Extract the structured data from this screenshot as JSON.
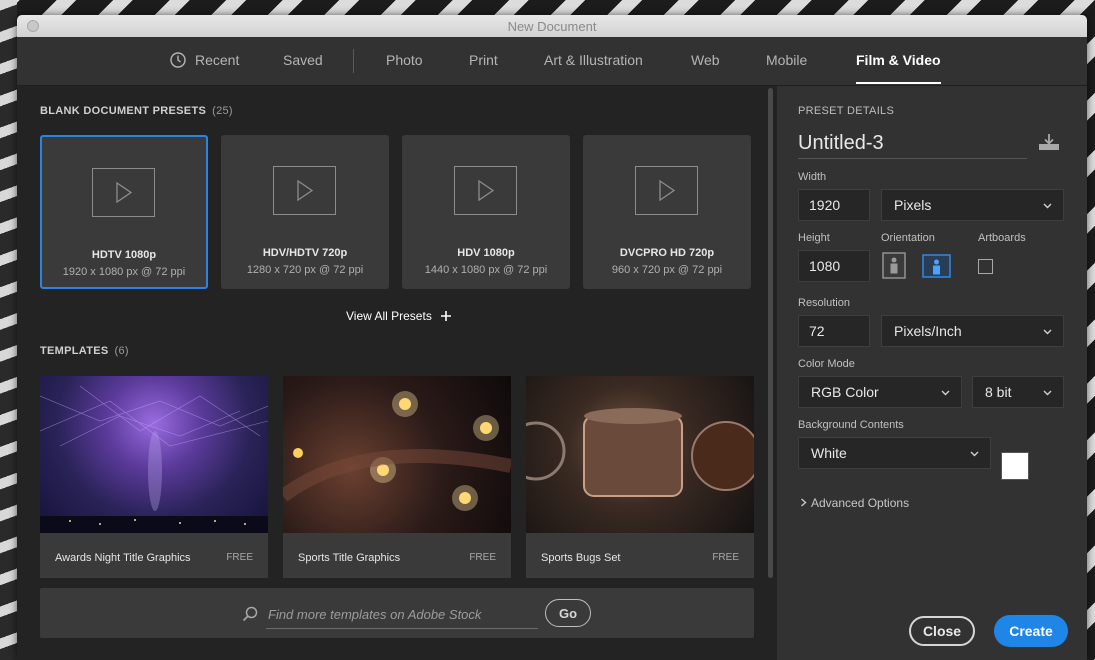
{
  "window": {
    "title": "New Document"
  },
  "tabs": [
    {
      "label": "Recent",
      "icon": "clock-icon"
    },
    {
      "label": "Saved"
    },
    {
      "label": "Photo"
    },
    {
      "label": "Print"
    },
    {
      "label": "Art & Illustration"
    },
    {
      "label": "Web"
    },
    {
      "label": "Mobile"
    },
    {
      "label": "Film & Video",
      "active": true
    }
  ],
  "presets_section": {
    "label": "BLANK DOCUMENT PRESETS",
    "count": "(25)"
  },
  "presets": [
    {
      "name": "HDTV 1080p",
      "dims": "1920 x 1080 px @ 72 ppi",
      "selected": true,
      "icon": "video-play-icon"
    },
    {
      "name": "HDV/HDTV 720p",
      "dims": "1280 x 720 px @ 72 ppi",
      "icon": "video-play-icon"
    },
    {
      "name": "HDV 1080p",
      "dims": "1440 x 1080 px @ 72 ppi",
      "icon": "video-play-icon"
    },
    {
      "name": "DVCPRO HD 720p",
      "dims": "960 x 720 px @ 72 ppi",
      "icon": "video-play-icon"
    }
  ],
  "view_all": {
    "label": "View All Presets",
    "icon": "plus-icon"
  },
  "templates_section": {
    "label": "TEMPLATES",
    "count": "(6)"
  },
  "templates": [
    {
      "name": "Awards Night Title Graphics",
      "price": "FREE"
    },
    {
      "name": "Sports Title Graphics",
      "price": "FREE"
    },
    {
      "name": "Sports Bugs Set",
      "price": "FREE"
    }
  ],
  "search": {
    "placeholder": "Find more templates on Adobe Stock",
    "value": "",
    "go_label": "Go",
    "icon": "search-icon"
  },
  "details": {
    "header": "PRESET DETAILS",
    "doc_name": "Untitled-3",
    "save_icon": "save-preset-icon",
    "width_label": "Width",
    "width_value": "1920",
    "width_unit": "Pixels",
    "height_label": "Height",
    "height_value": "1080",
    "orientation_label": "Orientation",
    "orientation_selected": "landscape",
    "artboards_label": "Artboards",
    "artboards_checked": false,
    "resolution_label": "Resolution",
    "resolution_value": "72",
    "resolution_unit": "Pixels/Inch",
    "color_mode_label": "Color Mode",
    "color_mode": "RGB Color",
    "bit_depth": "8 bit",
    "background_label": "Background Contents",
    "background": "White",
    "background_color": "#ffffff",
    "advanced_label": "Advanced Options"
  },
  "actions": {
    "close_label": "Close",
    "create_label": "Create"
  },
  "colors": {
    "accent": "#1f86e8",
    "selection_border": "#2d84e0",
    "panel": "#323232",
    "content": "#232323"
  }
}
